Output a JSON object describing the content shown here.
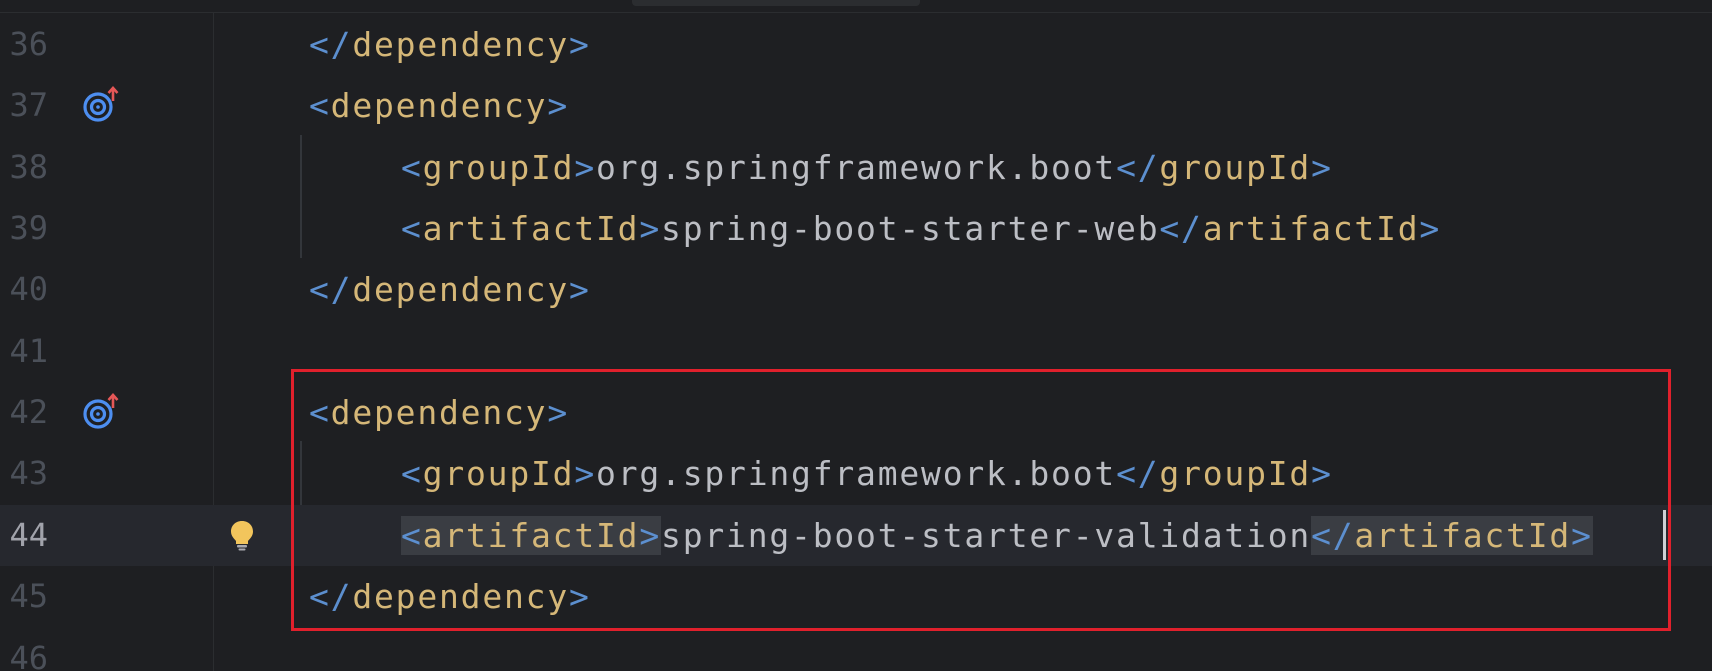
{
  "colors": {
    "background": "#1e1f22",
    "line_number": "#4b5059",
    "tag_bracket": "#5c8fcf",
    "tag_name": "#d5b778",
    "text": "#bcbec4",
    "highlight_box": "#e0202c",
    "current_line": "#26282e"
  },
  "icons": {
    "gutter": "maven-dependency-update-icon",
    "intention": "lightbulb-icon"
  },
  "lines": [
    {
      "no": "36",
      "lt": "</",
      "name": "dependency",
      "gt": ">"
    },
    {
      "no": "37",
      "lt": "<",
      "name": "dependency",
      "gt": ">"
    },
    {
      "no": "38",
      "lt": "<",
      "name": "groupId",
      "gt": ">",
      "text": "org.springframework.boot",
      "lt2": "</",
      "name2": "groupId",
      "gt2": ">"
    },
    {
      "no": "39",
      "lt": "<",
      "name": "artifactId",
      "gt": ">",
      "text": "spring-boot-starter-web",
      "lt2": "</",
      "name2": "artifactId",
      "gt2": ">"
    },
    {
      "no": "40",
      "lt": "</",
      "name": "dependency",
      "gt": ">"
    },
    {
      "no": "41"
    },
    {
      "no": "42",
      "lt": "<",
      "name": "dependency",
      "gt": ">"
    },
    {
      "no": "43",
      "lt": "<",
      "name": "groupId",
      "gt": ">",
      "text": "org.springframework.boot",
      "lt2": "</",
      "name2": "groupId",
      "gt2": ">"
    },
    {
      "no": "44",
      "lt": "<",
      "name": "artifactId",
      "gt": ">",
      "text": "spring-boot-starter-validation",
      "lt2": "</",
      "name2": "artifactId",
      "gt2": ">"
    },
    {
      "no": "45",
      "lt": "</",
      "name": "dependency",
      "gt": ">"
    },
    {
      "no": "46"
    }
  ]
}
